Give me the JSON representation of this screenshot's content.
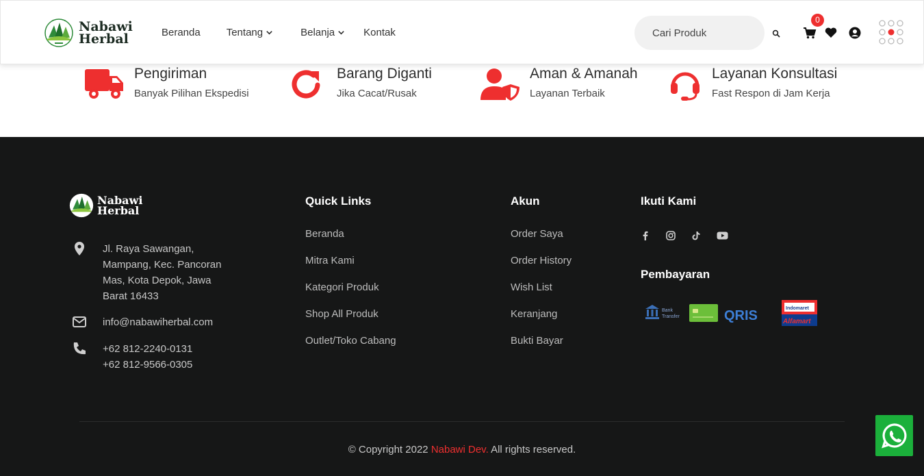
{
  "brand": {
    "line1": "Nabawi",
    "line2": "Herbal"
  },
  "nav": [
    {
      "label": "Beranda"
    },
    {
      "label": "Tentang"
    },
    {
      "label": "Belanja"
    },
    {
      "label": "Kontak"
    }
  ],
  "search": {
    "placeholder": "Cari Produk"
  },
  "cart": {
    "count": "0"
  },
  "features": [
    {
      "title": "Pengiriman",
      "subtitle": "Banyak Pilihan Ekspedisi",
      "icon": "truck-icon"
    },
    {
      "title": "Barang Diganti",
      "subtitle": "Jika Cacat/Rusak",
      "icon": "redo-icon"
    },
    {
      "title": "Aman & Amanah",
      "subtitle": "Layanan Terbaik",
      "icon": "user-shield-icon"
    },
    {
      "title": "Layanan Konsultasi",
      "subtitle": "Fast Respon di Jam Kerja",
      "icon": "headset-icon"
    }
  ],
  "footer": {
    "address": "Jl. Raya Sawangan,\nMampang, Kec. Pancoran\nMas, Kota Depok, Jawa\nBarat 16433",
    "email": "info@nabawiherbal.com",
    "phone": "+62 812-2240-0131\n+62 812-9566-0305",
    "quick_links": {
      "title": "Quick Links",
      "items": [
        "Beranda",
        "Mitra Kami",
        "Kategori Produk",
        "Shop All Produk",
        "Outlet/Toko Cabang"
      ]
    },
    "account": {
      "title": "Akun",
      "items": [
        "Order Saya",
        "Order History",
        "Wish List",
        "Keranjang",
        "Bukti Bayar"
      ]
    },
    "follow": {
      "title": "Ikuti Kami"
    },
    "payment": {
      "title": "Pembayaran",
      "bank_transfer_line1": "Bank",
      "bank_transfer_line2": "Transfer",
      "qris": "QRIS",
      "indomaret": "Indomaret",
      "alfamart": "Alfamart"
    },
    "copyright_prefix": "© Copyright 2022 ",
    "copyright_brand": "Nabawi Dev.",
    "copyright_suffix": " All rights reserved."
  },
  "colors": {
    "accent": "#ee2f2f",
    "footer_bg": "#161717",
    "whatsapp": "#1bb03b"
  }
}
